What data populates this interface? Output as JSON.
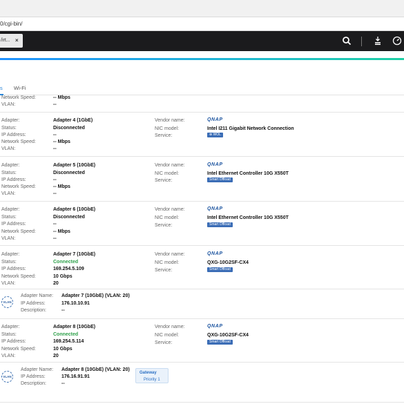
{
  "browser": {
    "address": "0/cgi-bin/"
  },
  "app_bar": {
    "tab_label": "/irt...",
    "tab_close": "×"
  },
  "tabs": [
    {
      "label": "s",
      "active": true
    },
    {
      "label": "Wi-Fi",
      "active": false
    }
  ],
  "labels": {
    "adapter": "Adapter:",
    "status": "Status:",
    "ip": "IP Address:",
    "speed": "Network Speed:",
    "vlan": "VLAN:",
    "vendor": "Vendor name:",
    "nic": "NIC model:",
    "service": "Service:",
    "adapter_name": "Adapter Name:",
    "description": "Description:"
  },
  "vendor_logo": "QNAP",
  "top_partial": {
    "speed": "-- Mbps",
    "vlan": "--"
  },
  "adapters": [
    {
      "name": "Adapter 4 (1GbE)",
      "status": "Disconnected",
      "ip": "--",
      "speed": "-- Mbps",
      "vlan": "--",
      "nic": "Intel I211 Gigabit Network Connection",
      "service": "⊛ WOL"
    },
    {
      "name": "Adapter 5 (10GbE)",
      "status": "Disconnected",
      "ip": "--",
      "speed": "-- Mbps",
      "vlan": "--",
      "nic": "Intel Ethernet Controller 10G X550T",
      "service": "Smart Offload"
    },
    {
      "name": "Adapter 6 (10GbE)",
      "status": "Disconnected",
      "ip": "--",
      "speed": "-- Mbps",
      "vlan": "--",
      "nic": "Intel Ethernet Controller 10G X550T",
      "service": "Smart Offload"
    },
    {
      "name": "Adapter 7 (10GbE)",
      "status": "Connected",
      "ip": "169.254.5.109",
      "speed": "10 Gbps",
      "vlan": "20",
      "nic": "QXG-10G2SF-CX4",
      "service": "Smart Offload"
    },
    {
      "name": "Adapter 8 (10GbE)",
      "status": "Connected",
      "ip": "169.254.5.114",
      "speed": "10 Gbps",
      "vlan": "20",
      "nic": "QXG-10G2SF-CX4",
      "service": "Smart Offload"
    }
  ],
  "vlans": [
    {
      "badge": "VLAN",
      "name": "Adapter 7 (10GbE) (VLAN: 20)",
      "ip": "176.10.10.91",
      "description": "--"
    },
    {
      "badge": "VLAN",
      "name": "Adapter 8 (10GbE) (VLAN: 20)",
      "ip": "176.16.91.91",
      "description": "--",
      "gateway": "Gateway",
      "priority": "Priority 1"
    }
  ],
  "colors": {
    "accent": "#2a86d8",
    "connected": "#2ea04a",
    "tag": "#3b6db6",
    "app_bar": "#1b1b1d"
  }
}
